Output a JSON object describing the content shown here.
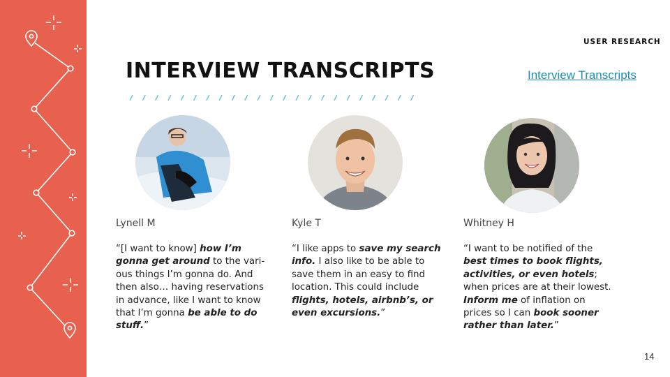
{
  "slide": {
    "section_label": "USER RESEARCH",
    "title": "INTERVIEW TRANSCRIPTS",
    "title_link": "Interview Transcripts",
    "page_number": "14"
  },
  "interviews": [
    {
      "name": "Lynell M",
      "quote": [
        {
          "t": "“[I want to know] "
        },
        {
          "t": "how I’m gonna get around",
          "b": true
        },
        {
          "t": " to the vari-ous things I’m gonna do. And then also… having reservations in advance, like I want to know that I’m gonna "
        },
        {
          "t": "be able to do stuff.",
          "b": true
        },
        {
          "t": "”"
        }
      ]
    },
    {
      "name": "Kyle T",
      "quote": [
        {
          "t": "“I like apps to "
        },
        {
          "t": "save my search info.",
          "b": true
        },
        {
          "t": " I also like to be able to save them in an easy to find location. This could include "
        },
        {
          "t": "flights, hotels, airbnb’s, or even excursions.",
          "b": true
        },
        {
          "t": "”"
        }
      ]
    },
    {
      "name": "Whitney H",
      "quote": [
        {
          "t": "“I want to be notified of the "
        },
        {
          "t": "best times to book flights, activities, or even hotels",
          "b": true
        },
        {
          "t": "; when prices are at their lowest. "
        },
        {
          "t": "Inform me",
          "b": true
        },
        {
          "t": " of inflation on prices so I can "
        },
        {
          "t": "book sooner rather than later.",
          "b": true
        },
        {
          "t": "”"
        }
      ]
    }
  ],
  "colors": {
    "accent": "#e8604e",
    "link": "#1a8fb0",
    "slash": "#6cc4c6"
  }
}
